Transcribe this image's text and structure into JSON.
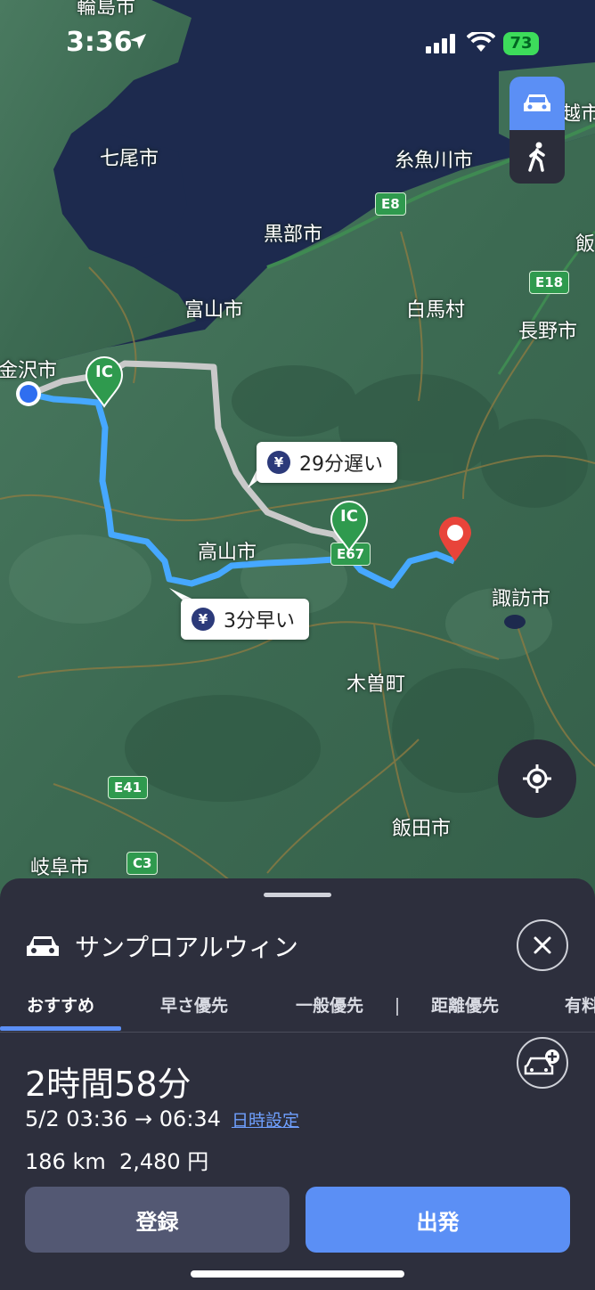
{
  "status_bar": {
    "time": "3:36",
    "battery": "73"
  },
  "map": {
    "labels": {
      "wajima": "輪島市",
      "nanao": "七尾市",
      "itoigawa": "糸魚川市",
      "kurobe": "黒部市",
      "toyama": "富山市",
      "hakuba": "白馬村",
      "nagano": "長野市",
      "kanazawa": "金沢市",
      "takayama": "高山市",
      "suwa": "諏訪市",
      "kiso": "木曽町",
      "iida": "飯田市",
      "gifu": "岐阜市",
      "etsu": "越市",
      "ii": "飯"
    },
    "road_shields": {
      "e8": "E8",
      "e18": "E18",
      "e67": "E67",
      "e41": "E41",
      "c3": "C3"
    },
    "ic_label": "IC",
    "callout_gray": "29分遅い",
    "callout_blue": "3分早い",
    "yen_symbol": "¥"
  },
  "sheet": {
    "destination": "サンプロアルウィン",
    "tabs": [
      "おすすめ",
      "早さ優先",
      "一般優先",
      "距離優先",
      "有料"
    ],
    "duration": "2時間58分",
    "time_range": "5/2 03:36 → 06:34",
    "date_link": "日時設定",
    "distance_fare": "186 km  2,480 円",
    "register_label": "登録",
    "start_label": "出発"
  },
  "colors": {
    "accent": "#5b8ff5",
    "route_main": "#46a8ff",
    "route_alt": "#c9c9c9",
    "sea": "#1d2a4e",
    "land": "#3d6b55"
  }
}
